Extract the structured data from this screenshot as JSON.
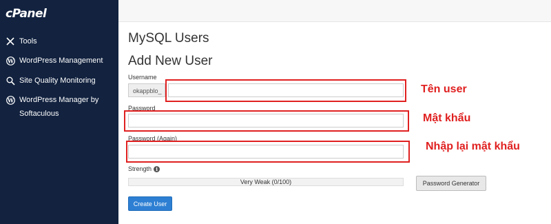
{
  "sidebar": {
    "logo": "cPanel",
    "items": [
      {
        "label": "Tools",
        "icon": "tools-icon"
      },
      {
        "label": "WordPress Management",
        "icon": "wordpress-icon"
      },
      {
        "label": "Site Quality Monitoring",
        "icon": "search-icon"
      },
      {
        "label": "WordPress Manager by Softaculous",
        "icon": "wordpress-icon"
      }
    ]
  },
  "page": {
    "title": "MySQL Users",
    "subtitle": "Add New User"
  },
  "form": {
    "username_label": "Username",
    "username_prefix": "okappblo_",
    "username_value": "",
    "password_label": "Password",
    "password_value": "",
    "password_again_label": "Password (Again)",
    "password_again_value": "",
    "strength_label": "Strength",
    "strength_value": "Very Weak (0/100)",
    "generator_button": "Password Generator",
    "create_button": "Create User"
  },
  "annotations": {
    "username": "Tên user",
    "password": "Mật khẩu",
    "password_again": "Nhập lại mật khẩu",
    "color": "#e02020"
  }
}
